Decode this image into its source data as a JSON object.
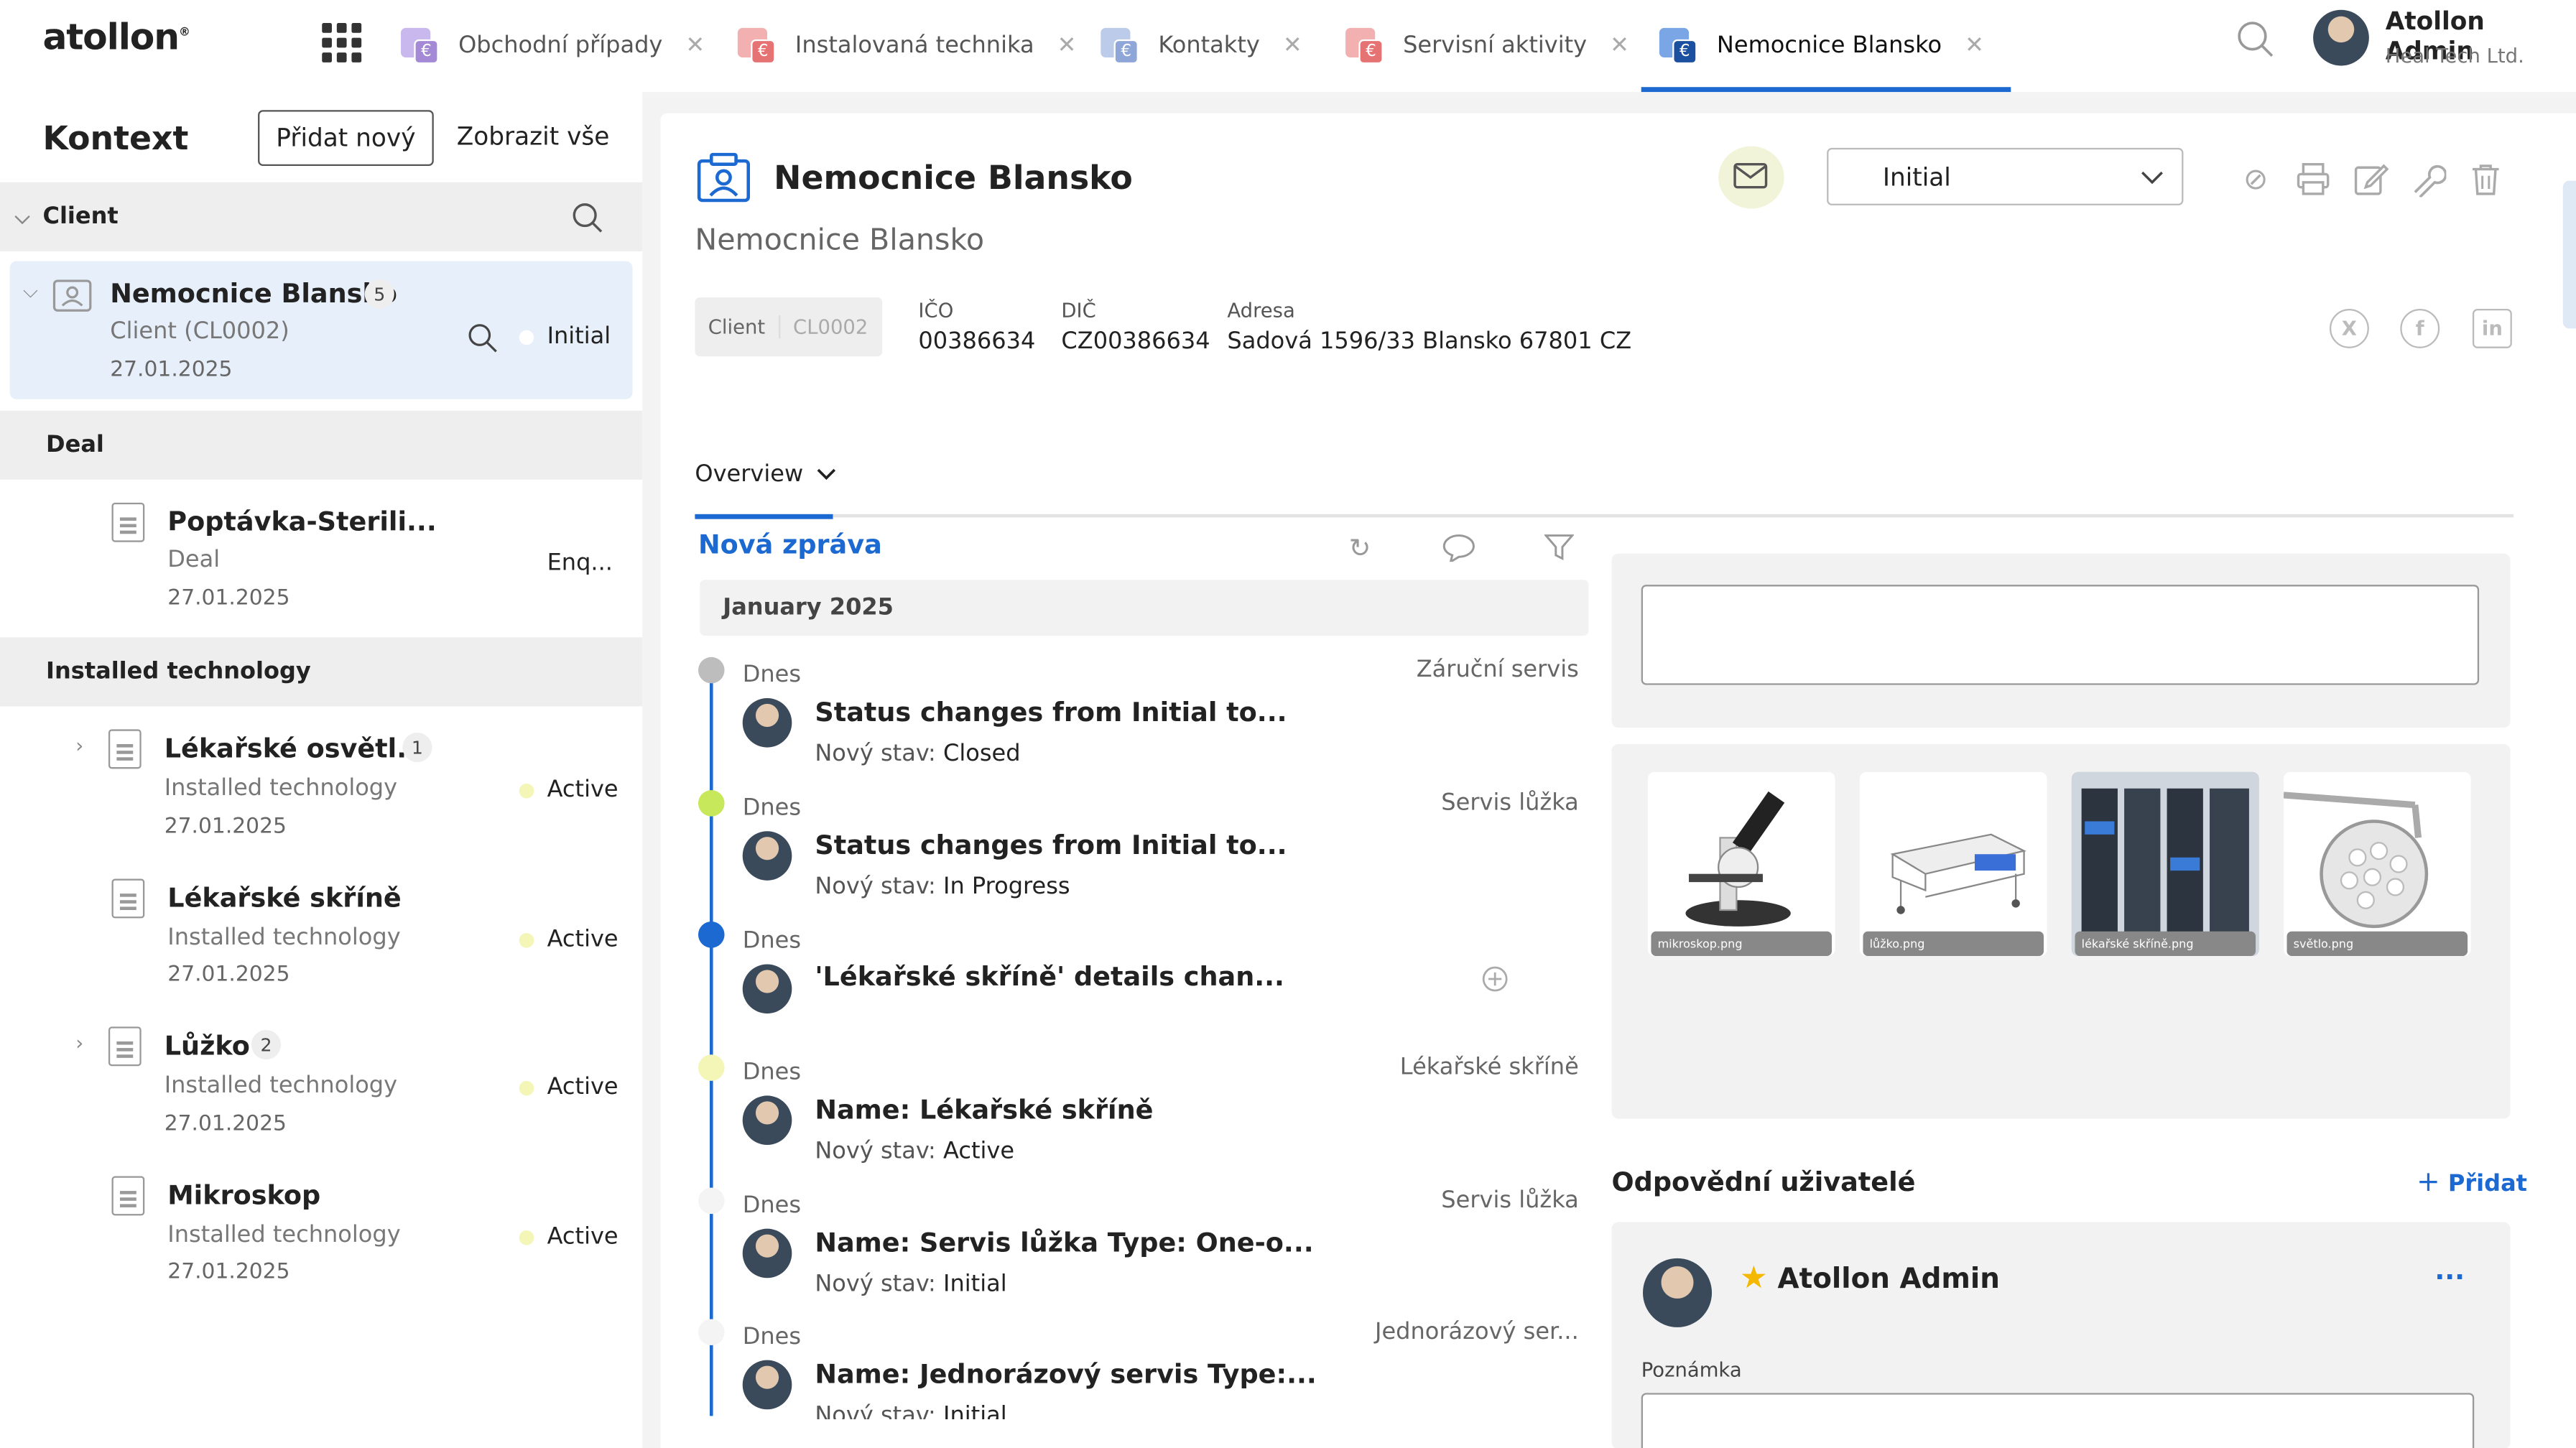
{
  "app": {
    "brand": "atollon"
  },
  "tabs": [
    {
      "label": "Obchodní případy",
      "color": "#a48ad6"
    },
    {
      "label": "Instalovaná technika",
      "color": "#e57373"
    },
    {
      "label": "Kontakty",
      "color": "#8fa7d8"
    },
    {
      "label": "Servisní aktivity",
      "color": "#e57373"
    },
    {
      "label": "Nemocnice Blansko",
      "color": "#1b69d1"
    }
  ],
  "user": {
    "name": "Atollon Admin",
    "company": "Heal Tech Ltd."
  },
  "left": {
    "title": "Kontext",
    "add_button": "Přidat nový",
    "show_all": "Zobrazit vše",
    "sections": {
      "client": "Client",
      "deal": "Deal",
      "installed": "Installed technology"
    },
    "client": {
      "name": "Nemocnice Blansko",
      "count": "5",
      "type": "Client (CL0002)",
      "date": "27.01.2025",
      "status": "Initial"
    },
    "deal": {
      "name": "Poptávka-Sterili...",
      "type": "Deal",
      "date": "27.01.2025",
      "status": "Enq..."
    },
    "installed": [
      {
        "name": "Lékařské osvětl...",
        "count": "1",
        "type": "Installed technology",
        "date": "27.01.2025",
        "status": "Active"
      },
      {
        "name": "Lékařské skříně",
        "type": "Installed technology",
        "date": "27.01.2025",
        "status": "Active"
      },
      {
        "name": "Lůžko",
        "count": "2",
        "type": "Installed technology",
        "date": "27.01.2025",
        "status": "Active"
      },
      {
        "name": "Mikroskop",
        "type": "Installed technology",
        "date": "27.01.2025",
        "status": "Active"
      }
    ]
  },
  "header": {
    "title": "Nemocnice Blansko",
    "subtitle": "Nemocnice Blansko",
    "status": "Initial",
    "chip_type": "Client",
    "chip_code": "CL0002",
    "ico_label": "IČO",
    "ico": "00386634",
    "dic_label": "DIČ",
    "dic": "CZ00386634",
    "addr_label": "Adresa",
    "addr": "Sadová 1596/33 Blansko 67801 CZ"
  },
  "overview": {
    "tab": "Overview",
    "new_message": "Nová zpráva",
    "month": "January 2025"
  },
  "timeline": [
    {
      "when": "Dnes",
      "title": "Status changes from Initial to...",
      "sub_label": "Nový stav:",
      "sub_value": "Closed",
      "right": "Záruční servis",
      "dot": "#bdbdbd"
    },
    {
      "when": "Dnes",
      "title": "Status changes from Initial to...",
      "sub_label": "Nový stav:",
      "sub_value": "In Progress",
      "right": "Servis lůžka",
      "dot": "#c7e85a"
    },
    {
      "when": "Dnes",
      "title": "'Lékařské skříně' details chan...",
      "sub_label": "",
      "sub_value": "",
      "right": "",
      "dot": "#1b69d1"
    },
    {
      "when": "Dnes",
      "title": "Name: Lékařské skříně",
      "sub_label": "Nový stav:",
      "sub_value": "Active",
      "right": "Lékařské skříně",
      "dot": "#f4f6b8"
    },
    {
      "when": "Dnes",
      "title": "Name: Servis lůžka Type: One-o...",
      "sub_label": "Nový stav:",
      "sub_value": "Initial",
      "right": "Servis lůžka",
      "dot": "#f4f4f4"
    },
    {
      "when": "Dnes",
      "title": "Name: Jednorázový servis Type:...",
      "sub_label": "Nový stav:",
      "sub_value": "Initial",
      "right": "Jednorázový ser...",
      "dot": "#f4f4f4"
    }
  ],
  "gallery": [
    {
      "caption": "mikroskop.png"
    },
    {
      "caption": "lůžko.png"
    },
    {
      "caption": "lékařské skříně.png"
    },
    {
      "caption": "světlo.png"
    }
  ],
  "responsible": {
    "title": "Odpovědní uživatelé",
    "add": "Přidat",
    "user": "Atollon Admin",
    "note_label": "Poznámka"
  }
}
